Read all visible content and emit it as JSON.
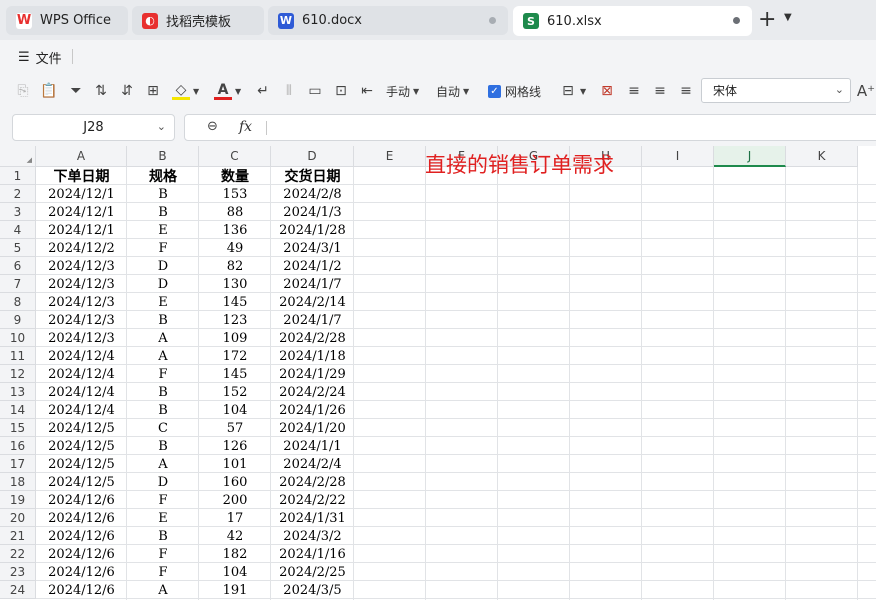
{
  "tabs": [
    {
      "label": "WPS Office",
      "icon": "wps-logo-icon",
      "color": "#e8302f"
    },
    {
      "label": "找稻壳模板",
      "icon": "docer-icon",
      "color": "#e8302f"
    },
    {
      "label": "610.docx",
      "icon": "word-doc-icon",
      "color": "#2f5bd6"
    },
    {
      "label": "610.xlsx",
      "icon": "sheet-icon",
      "color": "#1e8a4c"
    }
  ],
  "menu": {
    "file_label": "文件"
  },
  "toolbar": {
    "fill_label": "手动",
    "auto_label": "自动",
    "gridlines_label": "网格线",
    "gridlines_checked": true,
    "font_name": "宋体"
  },
  "formula_bar": {
    "cell_ref": "J28",
    "fx_label": "fx",
    "formula": ""
  },
  "columns": [
    "A",
    "B",
    "C",
    "D",
    "E",
    "F",
    "G",
    "H",
    "I",
    "J",
    "K"
  ],
  "selected_column": "J",
  "row_numbers": [
    "1",
    "2",
    "3",
    "4",
    "5",
    "6",
    "7",
    "8",
    "9",
    "10",
    "11",
    "12",
    "13",
    "14",
    "15",
    "16",
    "17",
    "18",
    "19",
    "20",
    "21",
    "22",
    "23",
    "24"
  ],
  "headers": [
    "下单日期",
    "规格",
    "数量",
    "交货日期"
  ],
  "rows": [
    [
      "2024/12/1",
      "B",
      "153",
      "2024/2/8"
    ],
    [
      "2024/12/1",
      "B",
      "88",
      "2024/1/3"
    ],
    [
      "2024/12/1",
      "E",
      "136",
      "2024/1/28"
    ],
    [
      "2024/12/2",
      "F",
      "49",
      "2024/3/1"
    ],
    [
      "2024/12/3",
      "D",
      "82",
      "2024/1/2"
    ],
    [
      "2024/12/3",
      "D",
      "130",
      "2024/1/7"
    ],
    [
      "2024/12/3",
      "E",
      "145",
      "2024/2/14"
    ],
    [
      "2024/12/3",
      "B",
      "123",
      "2024/1/7"
    ],
    [
      "2024/12/3",
      "A",
      "109",
      "2024/2/28"
    ],
    [
      "2024/12/4",
      "A",
      "172",
      "2024/1/18"
    ],
    [
      "2024/12/4",
      "F",
      "145",
      "2024/1/29"
    ],
    [
      "2024/12/4",
      "B",
      "152",
      "2024/2/24"
    ],
    [
      "2024/12/4",
      "B",
      "104",
      "2024/1/26"
    ],
    [
      "2024/12/5",
      "C",
      "57",
      "2024/1/20"
    ],
    [
      "2024/12/5",
      "B",
      "126",
      "2024/1/1"
    ],
    [
      "2024/12/5",
      "A",
      "101",
      "2024/2/4"
    ],
    [
      "2024/12/5",
      "D",
      "160",
      "2024/2/28"
    ],
    [
      "2024/12/6",
      "F",
      "200",
      "2024/2/22"
    ],
    [
      "2024/12/6",
      "E",
      "17",
      "2024/1/31"
    ],
    [
      "2024/12/6",
      "B",
      "42",
      "2024/3/2"
    ],
    [
      "2024/12/6",
      "F",
      "182",
      "2024/1/16"
    ],
    [
      "2024/12/6",
      "F",
      "104",
      "2024/2/25"
    ],
    [
      "2024/12/6",
      "A",
      "191",
      "2024/3/5"
    ]
  ],
  "note": "直接的销售订单需求",
  "colors": {
    "accent_green": "#1e8a4c",
    "note_red": "#e02020",
    "checkbox_blue": "#2f6fe0"
  }
}
